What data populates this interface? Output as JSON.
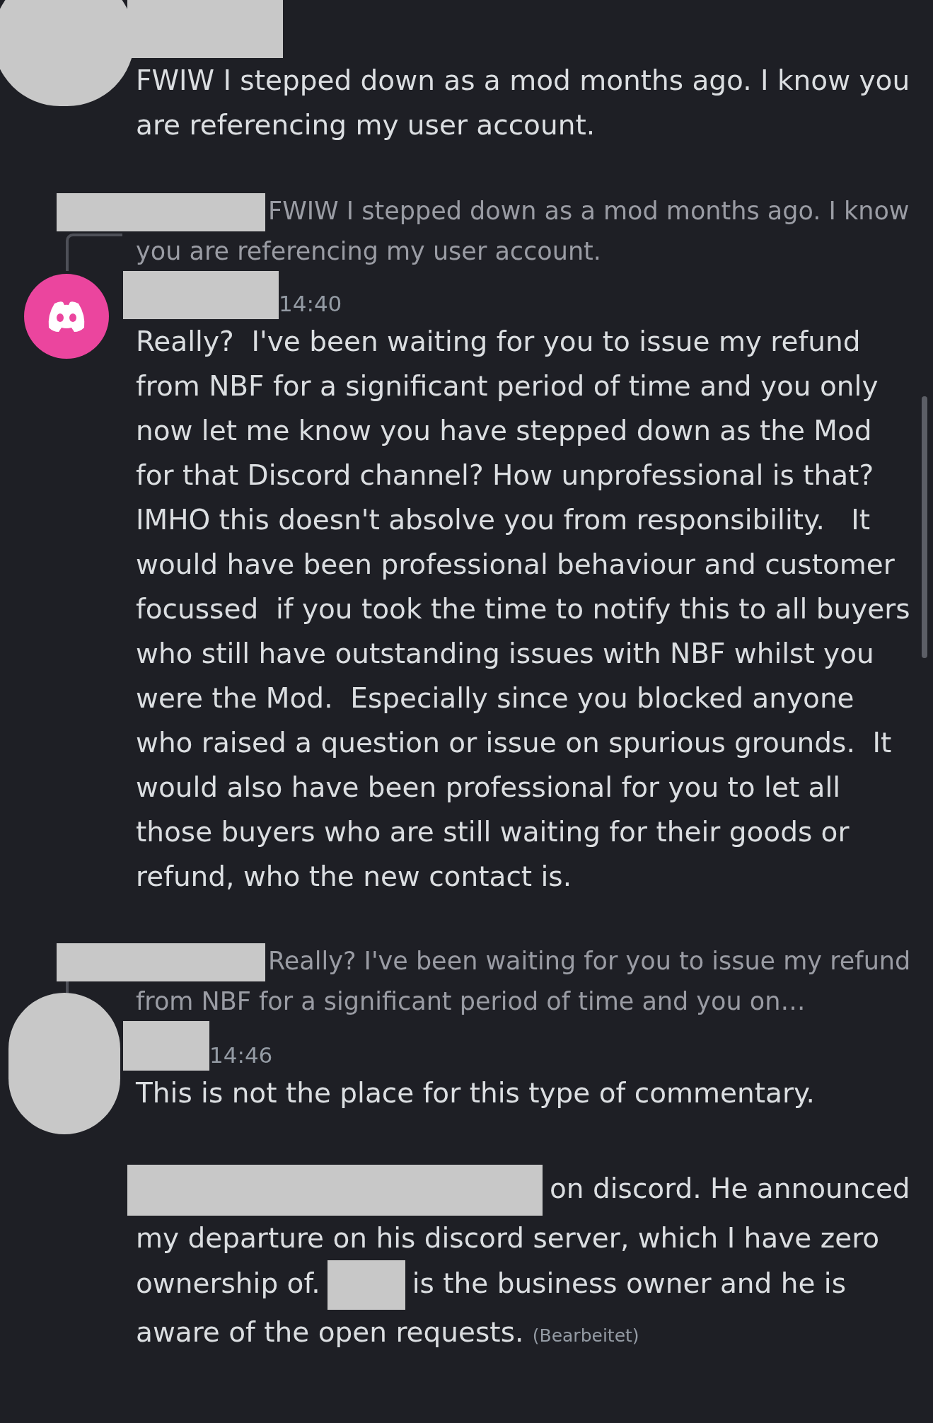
{
  "messages": [
    {
      "kind": "continued",
      "text": "FWIW I stepped down as a mod months ago. I know you are referencing my user account."
    },
    {
      "kind": "reply",
      "avatar": {
        "kind": "logo"
      },
      "reply_text": "FWIW I stepped down as a mod months ago. I know you are referencing my user account.",
      "time": "14:40",
      "text": "Really?  I've been waiting for you to issue my refund from NBF for a significant period of time and you only now let me know you have stepped down as the Mod for that Discord channel? How unprofessional is that? IMHO this doesn't absolve you from responsibility.   It would have been professional behaviour and customer focussed  if you took the time to notify this to all buyers who still have outstanding issues with NBF whilst you were the Mod.  Especially since you blocked anyone who raised a question or issue on spurious grounds.  It would also have been professional for you to let all those buyers who are still waiting for their goods or refund, who the new contact is."
    },
    {
      "kind": "reply",
      "avatar": {
        "kind": "plain"
      },
      "reply_text": "Really?  I've been waiting for you to issue my refund from NBF for a significant period of time and you on…",
      "time": "14:46",
      "text": "This is not the place for this type of commentary."
    },
    {
      "kind": "redacted",
      "segments": [
        "on discord. He announced my departure on his discord server, which I have zero ownership of.",
        "is the business owner and he is aware of the open requests."
      ],
      "edited": "(Bearbeitet)"
    }
  ]
}
